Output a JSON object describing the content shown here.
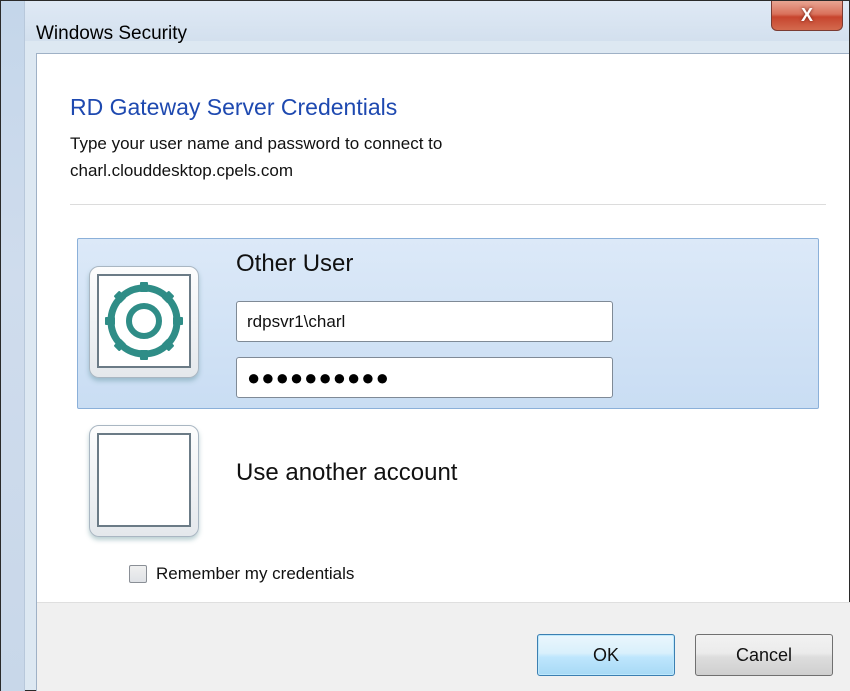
{
  "window": {
    "title": "Windows Security",
    "close_label": "X"
  },
  "dialog": {
    "heading": "RD Gateway Server Credentials",
    "description_line1": "Type your user name and password to connect to",
    "description_line2": "charl.clouddesktop.cpels.com"
  },
  "selected_tile": {
    "user_label": "Other User",
    "icon": "settings-gear-icon",
    "username_value": "rdpsvr1\\charl",
    "password_mask": "●●●●●●●●●●"
  },
  "other_tile": {
    "label": "Use another account",
    "icon": "blank-user-tile"
  },
  "remember": {
    "label": "Remember my credentials",
    "checked": false
  },
  "buttons": {
    "ok_label": "OK",
    "cancel_label": "Cancel"
  },
  "colors": {
    "heading": "#1e49b0",
    "gear": "#2f8d87",
    "close_button": "#c7452e",
    "selected_tile": "#c9ddf3"
  }
}
